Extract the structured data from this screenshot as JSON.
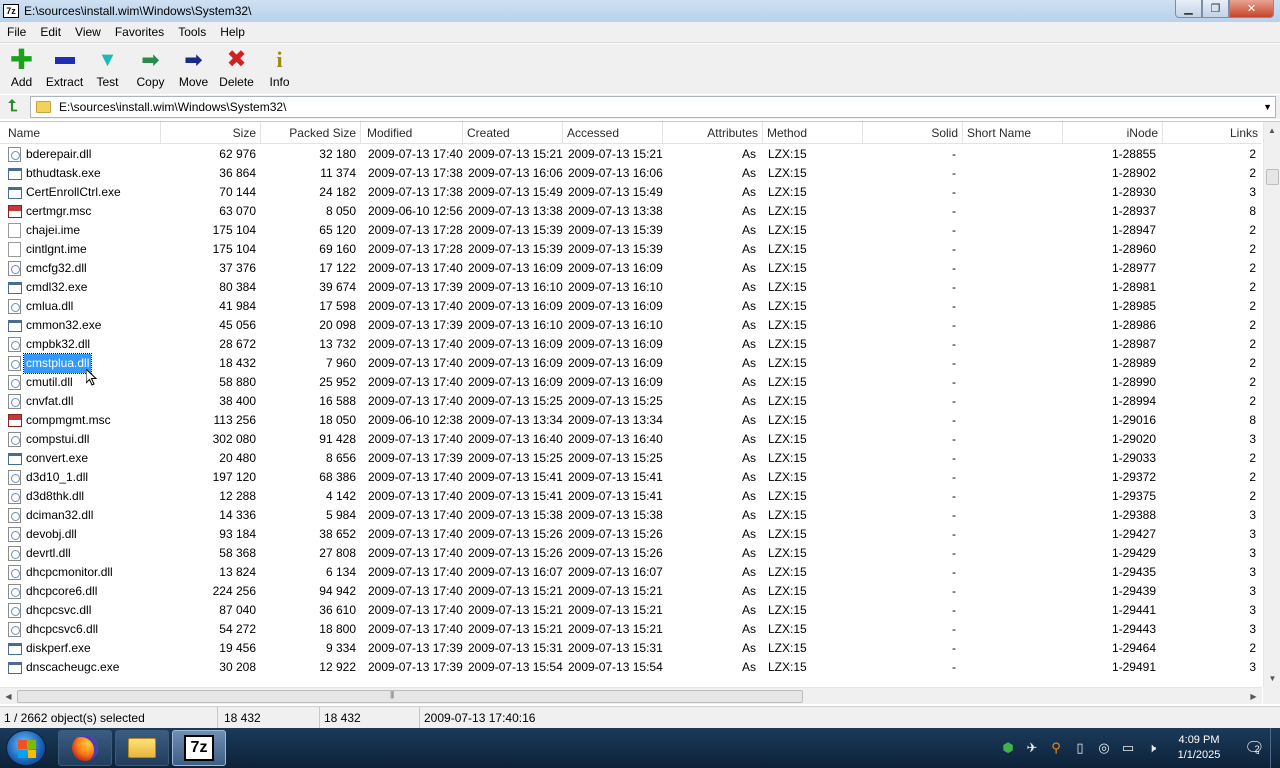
{
  "window": {
    "title": "E:\\sources\\install.wim\\Windows\\System32\\",
    "app_icon": "7z"
  },
  "menu": [
    "File",
    "Edit",
    "View",
    "Favorites",
    "Tools",
    "Help"
  ],
  "toolbar": [
    {
      "label": "Add",
      "icon": "plus-icon",
      "color": "#1aa31a"
    },
    {
      "label": "Extract",
      "icon": "minus-icon",
      "color": "#1f2fb5"
    },
    {
      "label": "Test",
      "icon": "checkmark-icon",
      "color": "#1fb8b8"
    },
    {
      "label": "Copy",
      "icon": "double-arrow-icon",
      "color": "#2a8c4a"
    },
    {
      "label": "Move",
      "icon": "arrow-right-icon",
      "color": "#1a2a8a"
    },
    {
      "label": "Delete",
      "icon": "x-icon",
      "color": "#d42020"
    },
    {
      "label": "Info",
      "icon": "info-icon",
      "color": "#9a8a10"
    }
  ],
  "address": {
    "path": "E:\\sources\\install.wim\\Windows\\System32\\"
  },
  "columns": [
    "Name",
    "Size",
    "Packed Size",
    "Modified",
    "Created",
    "Accessed",
    "Attributes",
    "Method",
    "Solid",
    "Short Name",
    "iNode",
    "Links"
  ],
  "files": [
    {
      "name": "bderepair.dll",
      "type": "dll",
      "size": "62 976",
      "packed": "32 180",
      "modified": "2009-07-13 17:40",
      "created": "2009-07-13 15:21",
      "accessed": "2009-07-13 15:21",
      "attr": "As",
      "method": "LZX:15",
      "solid": "-",
      "inode": "1-28855",
      "links": "2"
    },
    {
      "name": "bthudtask.exe",
      "type": "exe",
      "size": "36 864",
      "packed": "11 374",
      "modified": "2009-07-13 17:38",
      "created": "2009-07-13 16:06",
      "accessed": "2009-07-13 16:06",
      "attr": "As",
      "method": "LZX:15",
      "solid": "-",
      "inode": "1-28902",
      "links": "2"
    },
    {
      "name": "CertEnrollCtrl.exe",
      "type": "exe",
      "size": "70 144",
      "packed": "24 182",
      "modified": "2009-07-13 17:38",
      "created": "2009-07-13 15:49",
      "accessed": "2009-07-13 15:49",
      "attr": "As",
      "method": "LZX:15",
      "solid": "-",
      "inode": "1-28930",
      "links": "3"
    },
    {
      "name": "certmgr.msc",
      "type": "msc",
      "size": "63 070",
      "packed": "8 050",
      "modified": "2009-06-10 12:56",
      "created": "2009-07-13 13:38",
      "accessed": "2009-07-13 13:38",
      "attr": "As",
      "method": "LZX:15",
      "solid": "-",
      "inode": "1-28937",
      "links": "8"
    },
    {
      "name": "chajei.ime",
      "type": "ime",
      "size": "175 104",
      "packed": "65 120",
      "modified": "2009-07-13 17:28",
      "created": "2009-07-13 15:39",
      "accessed": "2009-07-13 15:39",
      "attr": "As",
      "method": "LZX:15",
      "solid": "-",
      "inode": "1-28947",
      "links": "2"
    },
    {
      "name": "cintlgnt.ime",
      "type": "ime",
      "size": "175 104",
      "packed": "69 160",
      "modified": "2009-07-13 17:28",
      "created": "2009-07-13 15:39",
      "accessed": "2009-07-13 15:39",
      "attr": "As",
      "method": "LZX:15",
      "solid": "-",
      "inode": "1-28960",
      "links": "2"
    },
    {
      "name": "cmcfg32.dll",
      "type": "dll",
      "size": "37 376",
      "packed": "17 122",
      "modified": "2009-07-13 17:40",
      "created": "2009-07-13 16:09",
      "accessed": "2009-07-13 16:09",
      "attr": "As",
      "method": "LZX:15",
      "solid": "-",
      "inode": "1-28977",
      "links": "2"
    },
    {
      "name": "cmdl32.exe",
      "type": "exe",
      "size": "80 384",
      "packed": "39 674",
      "modified": "2009-07-13 17:39",
      "created": "2009-07-13 16:10",
      "accessed": "2009-07-13 16:10",
      "attr": "As",
      "method": "LZX:15",
      "solid": "-",
      "inode": "1-28981",
      "links": "2"
    },
    {
      "name": "cmlua.dll",
      "type": "dll",
      "size": "41 984",
      "packed": "17 598",
      "modified": "2009-07-13 17:40",
      "created": "2009-07-13 16:09",
      "accessed": "2009-07-13 16:09",
      "attr": "As",
      "method": "LZX:15",
      "solid": "-",
      "inode": "1-28985",
      "links": "2"
    },
    {
      "name": "cmmon32.exe",
      "type": "exe",
      "size": "45 056",
      "packed": "20 098",
      "modified": "2009-07-13 17:39",
      "created": "2009-07-13 16:10",
      "accessed": "2009-07-13 16:10",
      "attr": "As",
      "method": "LZX:15",
      "solid": "-",
      "inode": "1-28986",
      "links": "2"
    },
    {
      "name": "cmpbk32.dll",
      "type": "dll",
      "size": "28 672",
      "packed": "13 732",
      "modified": "2009-07-13 17:40",
      "created": "2009-07-13 16:09",
      "accessed": "2009-07-13 16:09",
      "attr": "As",
      "method": "LZX:15",
      "solid": "-",
      "inode": "1-28987",
      "links": "2"
    },
    {
      "name": "cmstplua.dll",
      "type": "dll",
      "selected": true,
      "size": "18 432",
      "packed": "7 960",
      "modified": "2009-07-13 17:40",
      "created": "2009-07-13 16:09",
      "accessed": "2009-07-13 16:09",
      "attr": "As",
      "method": "LZX:15",
      "solid": "-",
      "inode": "1-28989",
      "links": "2"
    },
    {
      "name": "cmutil.dll",
      "type": "dll",
      "size": "58 880",
      "packed": "25 952",
      "modified": "2009-07-13 17:40",
      "created": "2009-07-13 16:09",
      "accessed": "2009-07-13 16:09",
      "attr": "As",
      "method": "LZX:15",
      "solid": "-",
      "inode": "1-28990",
      "links": "2"
    },
    {
      "name": "cnvfat.dll",
      "type": "dll",
      "size": "38 400",
      "packed": "16 588",
      "modified": "2009-07-13 17:40",
      "created": "2009-07-13 15:25",
      "accessed": "2009-07-13 15:25",
      "attr": "As",
      "method": "LZX:15",
      "solid": "-",
      "inode": "1-28994",
      "links": "2"
    },
    {
      "name": "compmgmt.msc",
      "type": "msc",
      "size": "113 256",
      "packed": "18 050",
      "modified": "2009-06-10 12:38",
      "created": "2009-07-13 13:34",
      "accessed": "2009-07-13 13:34",
      "attr": "As",
      "method": "LZX:15",
      "solid": "-",
      "inode": "1-29016",
      "links": "8"
    },
    {
      "name": "compstui.dll",
      "type": "dll",
      "size": "302 080",
      "packed": "91 428",
      "modified": "2009-07-13 17:40",
      "created": "2009-07-13 16:40",
      "accessed": "2009-07-13 16:40",
      "attr": "As",
      "method": "LZX:15",
      "solid": "-",
      "inode": "1-29020",
      "links": "3"
    },
    {
      "name": "convert.exe",
      "type": "exe",
      "size": "20 480",
      "packed": "8 656",
      "modified": "2009-07-13 17:39",
      "created": "2009-07-13 15:25",
      "accessed": "2009-07-13 15:25",
      "attr": "As",
      "method": "LZX:15",
      "solid": "-",
      "inode": "1-29033",
      "links": "2"
    },
    {
      "name": "d3d10_1.dll",
      "type": "dll",
      "size": "197 120",
      "packed": "68 386",
      "modified": "2009-07-13 17:40",
      "created": "2009-07-13 15:41",
      "accessed": "2009-07-13 15:41",
      "attr": "As",
      "method": "LZX:15",
      "solid": "-",
      "inode": "1-29372",
      "links": "2"
    },
    {
      "name": "d3d8thk.dll",
      "type": "dll",
      "size": "12 288",
      "packed": "4 142",
      "modified": "2009-07-13 17:40",
      "created": "2009-07-13 15:41",
      "accessed": "2009-07-13 15:41",
      "attr": "As",
      "method": "LZX:15",
      "solid": "-",
      "inode": "1-29375",
      "links": "2"
    },
    {
      "name": "dciman32.dll",
      "type": "dll",
      "size": "14 336",
      "packed": "5 984",
      "modified": "2009-07-13 17:40",
      "created": "2009-07-13 15:38",
      "accessed": "2009-07-13 15:38",
      "attr": "As",
      "method": "LZX:15",
      "solid": "-",
      "inode": "1-29388",
      "links": "3"
    },
    {
      "name": "devobj.dll",
      "type": "dll",
      "size": "93 184",
      "packed": "38 652",
      "modified": "2009-07-13 17:40",
      "created": "2009-07-13 15:26",
      "accessed": "2009-07-13 15:26",
      "attr": "As",
      "method": "LZX:15",
      "solid": "-",
      "inode": "1-29427",
      "links": "3"
    },
    {
      "name": "devrtl.dll",
      "type": "dll",
      "size": "58 368",
      "packed": "27 808",
      "modified": "2009-07-13 17:40",
      "created": "2009-07-13 15:26",
      "accessed": "2009-07-13 15:26",
      "attr": "As",
      "method": "LZX:15",
      "solid": "-",
      "inode": "1-29429",
      "links": "3"
    },
    {
      "name": "dhcpcmonitor.dll",
      "type": "dll",
      "size": "13 824",
      "packed": "6 134",
      "modified": "2009-07-13 17:40",
      "created": "2009-07-13 16:07",
      "accessed": "2009-07-13 16:07",
      "attr": "As",
      "method": "LZX:15",
      "solid": "-",
      "inode": "1-29435",
      "links": "3"
    },
    {
      "name": "dhcpcore6.dll",
      "type": "dll",
      "size": "224 256",
      "packed": "94 942",
      "modified": "2009-07-13 17:40",
      "created": "2009-07-13 15:21",
      "accessed": "2009-07-13 15:21",
      "attr": "As",
      "method": "LZX:15",
      "solid": "-",
      "inode": "1-29439",
      "links": "3"
    },
    {
      "name": "dhcpcsvc.dll",
      "type": "dll",
      "size": "87 040",
      "packed": "36 610",
      "modified": "2009-07-13 17:40",
      "created": "2009-07-13 15:21",
      "accessed": "2009-07-13 15:21",
      "attr": "As",
      "method": "LZX:15",
      "solid": "-",
      "inode": "1-29441",
      "links": "3"
    },
    {
      "name": "dhcpcsvc6.dll",
      "type": "dll",
      "size": "54 272",
      "packed": "18 800",
      "modified": "2009-07-13 17:40",
      "created": "2009-07-13 15:21",
      "accessed": "2009-07-13 15:21",
      "attr": "As",
      "method": "LZX:15",
      "solid": "-",
      "inode": "1-29443",
      "links": "3"
    },
    {
      "name": "diskperf.exe",
      "type": "exe",
      "size": "19 456",
      "packed": "9 334",
      "modified": "2009-07-13 17:39",
      "created": "2009-07-13 15:31",
      "accessed": "2009-07-13 15:31",
      "attr": "As",
      "method": "LZX:15",
      "solid": "-",
      "inode": "1-29464",
      "links": "2"
    },
    {
      "name": "dnscacheugc.exe",
      "type": "exe",
      "size": "30 208",
      "packed": "12 922",
      "modified": "2009-07-13 17:39",
      "created": "2009-07-13 15:54",
      "accessed": "2009-07-13 15:54",
      "attr": "As",
      "method": "LZX:15",
      "solid": "-",
      "inode": "1-29491",
      "links": "3"
    }
  ],
  "status": {
    "selection": "1 / 2662 object(s) selected",
    "size": "18 432",
    "packed": "18 432",
    "date": "2009-07-13 17:40:16"
  },
  "taskbar": {
    "apps": [
      {
        "name": "firefox-icon",
        "active": false
      },
      {
        "name": "folder-icon",
        "active": false
      },
      {
        "name": "7zip-icon",
        "label": "7z",
        "active": true
      }
    ],
    "time": "4:09 PM",
    "date": "1/1/2025",
    "notifications": "2"
  }
}
